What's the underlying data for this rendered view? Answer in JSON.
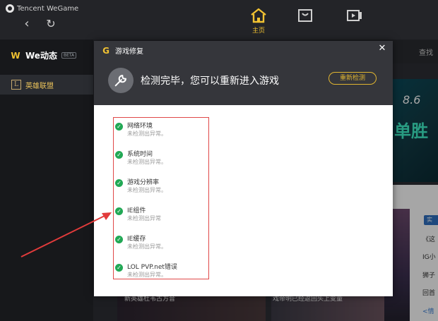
{
  "app": {
    "brand": "Tencent WeGame"
  },
  "topnav": {
    "home_label": "主页"
  },
  "sidebar": {
    "logo_text": "We动态",
    "beta_label": "BETA",
    "items": [
      {
        "label": "英雄联盟"
      }
    ]
  },
  "background": {
    "search_label": "查找",
    "banner_date": "8.6",
    "banner_text": "单胜",
    "tag": "实",
    "news": [
      "《这",
      "IG小",
      "狮子",
      "回首",
      "<情"
    ],
    "caption_left": "新英雄杜韦古方音",
    "caption_right": "戏帝明已经返回头上变量"
  },
  "modal": {
    "title": "游戏修复",
    "headline": "检测完毕，您可以重新进入游戏",
    "recheck_label": "重新检测",
    "checks": [
      {
        "name": "网络环境",
        "status": "未检测出异常。"
      },
      {
        "name": "系统时间",
        "status": "未检测出异常。"
      },
      {
        "name": "游戏分辨率",
        "status": "未检测出异常。"
      },
      {
        "name": "IE组件",
        "status": "未检测出异常"
      },
      {
        "name": "IE缓存",
        "status": "未检测出异常。"
      },
      {
        "name": "LOL PVP.net错误",
        "status": "未检测出异常。"
      }
    ]
  },
  "colors": {
    "accent": "#f1c232",
    "success": "#22a855",
    "highlight_border": "#e04848"
  }
}
